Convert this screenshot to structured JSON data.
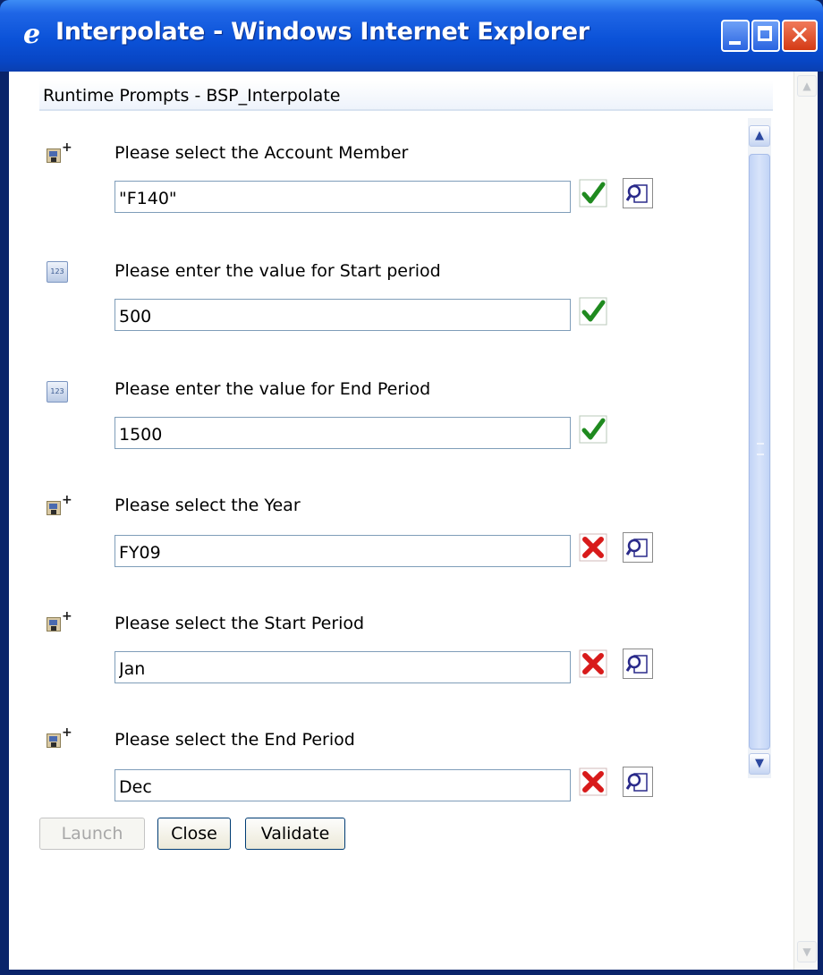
{
  "window": {
    "title": "Interpolate - Windows Internet Explorer",
    "icon": "ie-icon",
    "controls": [
      "minimize",
      "maximize",
      "close"
    ]
  },
  "header": {
    "title": "Runtime Prompts - BSP_Interpolate"
  },
  "prompts": [
    {
      "icon": "member-selection-icon",
      "label": "Please select the Account Member",
      "value": "\"F140\"",
      "status": "valid",
      "has_lookup": true
    },
    {
      "icon": "numeric-entry-icon",
      "label": "Please enter the value for Start period",
      "value": "500",
      "status": "valid",
      "has_lookup": false
    },
    {
      "icon": "numeric-entry-icon",
      "label": "Please enter the value for End Period",
      "value": "1500",
      "status": "valid",
      "has_lookup": false
    },
    {
      "icon": "member-selection-icon",
      "label": "Please select the Year",
      "value": "FY09",
      "status": "invalid",
      "has_lookup": true
    },
    {
      "icon": "member-selection-icon",
      "label": "Please select the Start Period",
      "value": "Jan",
      "status": "invalid",
      "has_lookup": true
    },
    {
      "icon": "member-selection-icon",
      "label": "Please select the End Period",
      "value": "Dec",
      "status": "invalid",
      "has_lookup": true
    }
  ],
  "buttons": {
    "launch": "Launch",
    "close": "Close",
    "validate": "Validate"
  },
  "colors": {
    "titlebar": "#0b52d8",
    "valid": "#1f8a1f",
    "invalid": "#d81a1a"
  }
}
